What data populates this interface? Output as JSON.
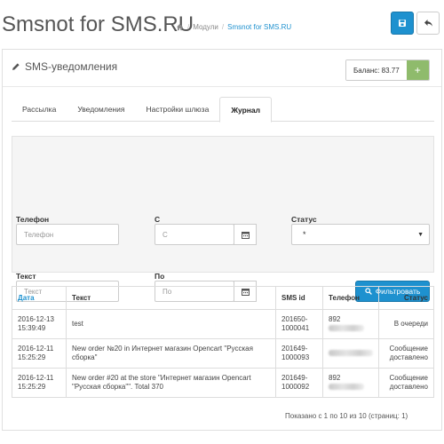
{
  "header": {
    "title": "Smsnot for SMS.RU",
    "breadcrumb": {
      "home_icon": "home-icon",
      "items": [
        "Модули",
        "Smsnot for SMS.RU"
      ]
    },
    "save_icon": "save-icon",
    "back_icon": "reply-icon",
    "accent": "#1e91cf"
  },
  "panel": {
    "title": "SMS-уведомления",
    "title_icon": "pencil-icon",
    "balance_label": "Баланс: 83.77",
    "balance_button": "+"
  },
  "tabs": [
    {
      "label": "Рассылка",
      "active": false
    },
    {
      "label": "Уведомления",
      "active": false
    },
    {
      "label": "Настройки шлюза",
      "active": false
    },
    {
      "label": "Журнал",
      "active": true
    }
  ],
  "filter": {
    "phone_label": "Телефон",
    "phone_placeholder": "Телефон",
    "from_label": "С",
    "from_placeholder": "С",
    "status_label": "Статус",
    "status_value": "*",
    "text_label": "Текст",
    "text_placeholder": "Текст",
    "to_label": "По",
    "to_placeholder": "По",
    "filter_button": "Фильтровать"
  },
  "table": {
    "headers": [
      "Дата",
      "Текст",
      "SMS id",
      "Телефон",
      "Статус"
    ],
    "rows": [
      {
        "date": "2016-12-13 15:39:49",
        "text": "test",
        "sms_id": "201650-1000041",
        "phone": "892",
        "status": "В очереди"
      },
      {
        "date": "2016-12-11 15:25:29",
        "text": "New order №20 in Интернет магазин Opencart \"Русская сборка\"",
        "sms_id": "201649-1000093",
        "phone": "",
        "status": "Сообщение доставлено"
      },
      {
        "date": "2016-12-11 15:25:29",
        "text": "New order #20 at the store \"Интернет магазин Opencart \"Русская сборка\"\". Total 370",
        "sms_id": "201649-1000092",
        "phone": "892",
        "status": "Сообщение доставлено"
      }
    ]
  },
  "pagination": {
    "info": "Показано с 1 по 10 из 10 (страниц: 1)"
  }
}
